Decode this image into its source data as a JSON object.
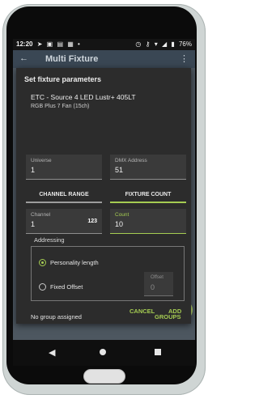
{
  "statusbar": {
    "time": "12:20",
    "left_icons": [
      "navigation-icon",
      "image-icon",
      "gallery-icon",
      "calendar-icon",
      "dot-icon"
    ],
    "battery": "76%"
  },
  "appbar": {
    "title": "Multi Fixture"
  },
  "dialog": {
    "title": "Set fixture parameters",
    "fixture_name": "ETC - Source 4 LED Lustr+ 405LT",
    "fixture_mode": "RGB Plus 7 Fan (15ch)",
    "universe": {
      "label": "Universe",
      "value": "1"
    },
    "dmx_address": {
      "label": "DMX Address",
      "value": "51"
    },
    "tabs": [
      {
        "label": "CHANNEL RANGE",
        "selected": false
      },
      {
        "label": "FIXTURE COUNT",
        "selected": true
      }
    ],
    "channel": {
      "label": "Channel",
      "value": "1",
      "badge": "123"
    },
    "count": {
      "label": "Count",
      "value": "10"
    },
    "addressing": {
      "label": "Addressing",
      "options": [
        {
          "label": "Personality length",
          "selected": true
        },
        {
          "label": "Fixed Offset",
          "selected": false
        }
      ],
      "offset": {
        "label": "Offset",
        "value": "0"
      }
    },
    "group_text": "No group assigned",
    "groups_button": "GROUPS",
    "cancel_button": "CANCEL",
    "add_button": "ADD"
  },
  "colors": {
    "accent": "#a5cc52",
    "dialog_bg": "#2c2c2c",
    "field_bg": "#3a3a3a",
    "appbar": "#3a4754",
    "fab": "#b7d66c"
  }
}
